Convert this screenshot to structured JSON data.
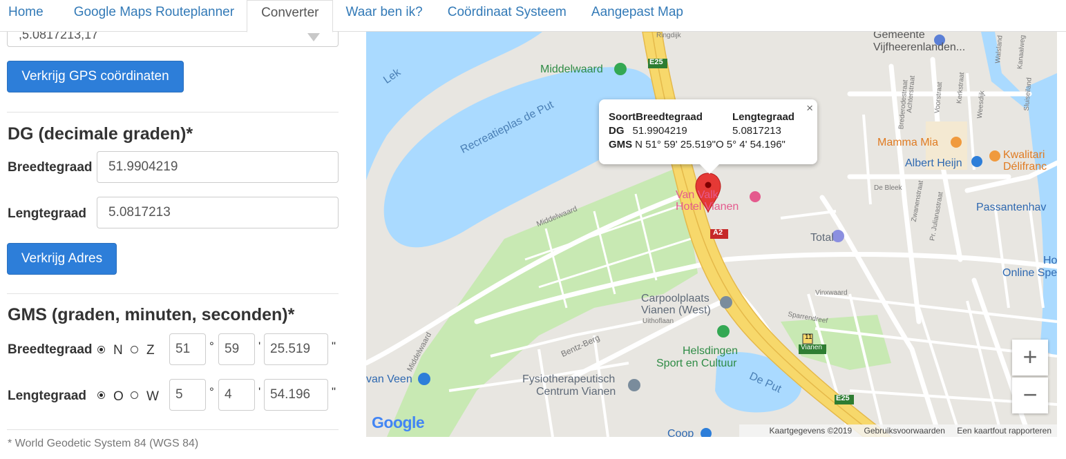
{
  "nav": {
    "tabs": [
      {
        "label": "Home"
      },
      {
        "label": "Google Maps Routeplanner"
      },
      {
        "label": "Converter"
      },
      {
        "label": "Waar ben ik?"
      },
      {
        "label": "Coördinaat Systeem"
      },
      {
        "label": "Aangepast Map"
      }
    ],
    "active_tab": "Converter"
  },
  "form": {
    "partial_select_value": ",5.0817213,17",
    "gps_button": "Verkrijg GPS coördinaten",
    "dg": {
      "heading": "DG (decimale graden)*",
      "lat_label": "Breedtegraad",
      "lat_value": "51.9904219",
      "lng_label": "Lengtegraad",
      "lng_value": "5.0817213",
      "button": "Verkrijg Adres"
    },
    "gms": {
      "heading": "GMS (graden, minuten, seconden)*",
      "lat_label": "Breedtegraad",
      "lat_dir_options": [
        "N",
        "Z"
      ],
      "lat_dir_selected": "N",
      "lat_deg": "51",
      "lat_min": "59",
      "lat_sec": "25.519",
      "lng_label": "Lengtegraad",
      "lng_dir_options": [
        "O",
        "W"
      ],
      "lng_dir_selected": "O",
      "lng_deg": "5",
      "lng_min": "4",
      "lng_sec": "54.196",
      "deg_symbol": "°",
      "min_symbol": "'",
      "sec_symbol": "\""
    },
    "footnote": "* World Geodetic System 84 (WGS 84)"
  },
  "map": {
    "infowindow": {
      "col1_header": "Soort",
      "col2_header": "Breedtegraad",
      "col3_header": "Lengtegraad",
      "row_dg_label": "DG",
      "row_dg_lat": "51.9904219",
      "row_dg_lng": "5.0817213",
      "row_gms_label": "GMS",
      "row_gms_lat": "N 51° 59' 25.519\"",
      "row_gms_lng": "O 5° 4' 54.196\"",
      "close": "×"
    },
    "labels": {
      "gemeente1": "Gemeente",
      "gemeente2": "Vijfheerenlanden...",
      "middelwaard": "Middelwaard",
      "e25a": "E25",
      "e25b": "E25",
      "a2": "A2",
      "lek": "Lek",
      "recreatieplas": "Recreatieplas de Put",
      "mamma_mia": "Mamma Mia",
      "kwalitaria": "Kwalitari",
      "delifranc": "Délifranc",
      "albert_heijn": "Albert Heijn",
      "van_valk1": "Van   Valk",
      "van_valk2": "Hotel Vianen",
      "passanten": "Passantenhav",
      "total": "Total",
      "online1": "Ho",
      "online2": "Online Spe",
      "carpool1": "Carpoolplaats",
      "carpool2": "Vianen (West)",
      "helsdingen1": "Helsdingen",
      "helsdingen2": "Sport en Cultuur",
      "de_put": "De Put",
      "van_veen": "van Veen",
      "fysio1": "Fysiotherapeutisch",
      "fysio2": "Centrum Vianen",
      "vianen_shield_num": "11",
      "vianen_shield_name": "Vianen",
      "coop": "Coop",
      "street_middelwaard1": "Middelwaard",
      "street_middelwaard2": "Middelwaard",
      "street_bentz": "Bentz-Berg",
      "street_uithof": "Uithoflaan",
      "street_vinxwaard": "Vinxwaard",
      "street_sparrendreef": "Sparrendreef",
      "street_debleek": "De Bleek",
      "street_zwanenstraat": "Zwanenstraat",
      "street_julianastraat": "Pr. Julianastraat",
      "street_voorstraat": "Voorstraat",
      "street_kerkstraat": "Kerkstraat",
      "street_achterstraat": "Achterstraat",
      "street_brederode": "Brederodestraat",
      "street_weesdijk": "Weesdijk",
      "street_walsland": "Walsland",
      "street_kanaalweg": "Kanaalweg",
      "street_sluiseiland": "Sluiseiland",
      "street_ringdijk": "Ringdijk"
    },
    "zoom_in": "+",
    "zoom_out": "−",
    "google_logo": "Google",
    "attribution": [
      "Kaartgegevens ©2019",
      "Gebruiksvoorwaarden",
      "Een kaartfout rapporteren"
    ],
    "colors": {
      "water": "#aadaff",
      "park": "#c8e9b3",
      "land": "#e8e6e1",
      "highway": "#f7d86b",
      "marker": "#e53935",
      "button": "#2d7ed9"
    }
  }
}
